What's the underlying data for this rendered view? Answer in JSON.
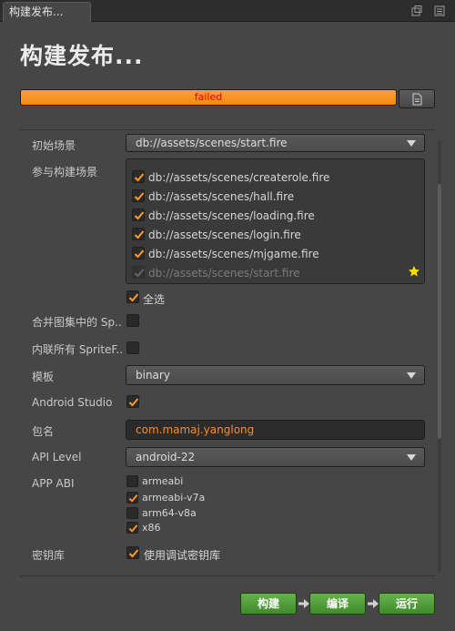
{
  "tab": {
    "title": "构建发布..."
  },
  "header": {
    "title": "构建发布..."
  },
  "progress": {
    "status_text": "failed",
    "percent": 100
  },
  "start_scene": {
    "label": "初始场景",
    "value": "db://assets/scenes/start.fire"
  },
  "included_scenes": {
    "label": "参与构建场景",
    "items": [
      {
        "path": "db://assets/scenes/createrole.fire",
        "checked": true
      },
      {
        "path": "db://assets/scenes/hall.fire",
        "checked": true
      },
      {
        "path": "db://assets/scenes/loading.fire",
        "checked": true
      },
      {
        "path": "db://assets/scenes/login.fire",
        "checked": true
      },
      {
        "path": "db://assets/scenes/mjgame.fire",
        "checked": true
      },
      {
        "path": "db://assets/scenes/start.fire",
        "checked": true,
        "disabled": true,
        "starred": true
      }
    ],
    "select_all_label": "全选"
  },
  "merge_atlas": {
    "label": "合并图集中的 Sp..",
    "checked": false
  },
  "inline_sprite": {
    "label": "内联所有 SpriteF..",
    "checked": false
  },
  "template": {
    "label": "模板",
    "value": "binary"
  },
  "android_studio": {
    "label": "Android Studio",
    "checked": true
  },
  "package": {
    "label": "包名",
    "value": "com.mamaj.yanglong"
  },
  "api_level": {
    "label": "API Level",
    "value": "android-22"
  },
  "app_abi": {
    "label": "APP ABI",
    "options": [
      {
        "name": "armeabi",
        "checked": false
      },
      {
        "name": "armeabi-v7a",
        "checked": true
      },
      {
        "name": "arm64-v8a",
        "checked": false
      },
      {
        "name": "x86",
        "checked": true
      }
    ]
  },
  "keystore": {
    "label": "密钥库",
    "option_label": "使用调试密钥库",
    "checked": true
  },
  "buttons": {
    "build": "构建",
    "compile": "编译",
    "run": "运行"
  },
  "colors": {
    "accent": "#f7931e",
    "panel": "#464646",
    "button_green": "#4e9b38",
    "error_text": "#e80000"
  }
}
